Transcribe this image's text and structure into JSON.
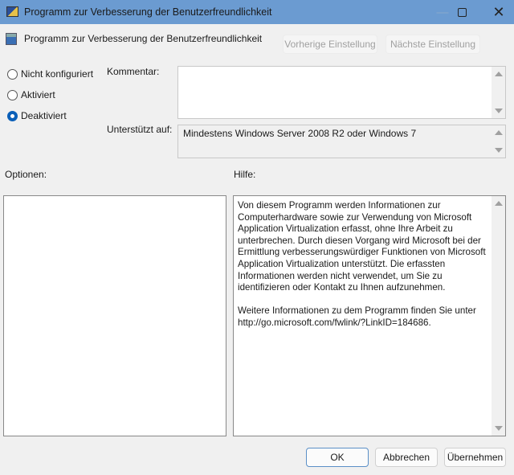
{
  "window": {
    "title": "Programm zur Verbesserung der Benutzerfreundlichkeit"
  },
  "header": {
    "title": "Programm zur Verbesserung der Benutzerfreundlichkeit",
    "prev": "Vorherige Einstellung",
    "next": "Nächste Einstellung"
  },
  "state": {
    "options": [
      "Nicht konfiguriert",
      "Aktiviert",
      "Deaktiviert"
    ],
    "selected": "Deaktiviert"
  },
  "comment": {
    "label": "Kommentar:",
    "value": ""
  },
  "supported": {
    "label": "Unterstützt auf:",
    "value": "Mindestens Windows Server 2008 R2 oder Windows 7"
  },
  "options_label": "Optionen:",
  "help": {
    "label": "Hilfe:",
    "p1": "Von diesem Programm werden Informationen zur Computerhardware sowie zur Verwendung von Microsoft Application Virtualization erfasst, ohne Ihre Arbeit zu unterbrechen. Durch diesen Vorgang wird Microsoft bei der Ermittlung verbesserungswürdiger Funktionen von Microsoft Application Virtualization unterstützt. Die erfassten Informationen werden nicht verwendet, um Sie zu identifizieren oder Kontakt zu Ihnen aufzunehmen.",
    "p2": "Weitere Informationen zu dem Programm finden Sie unter http://go.microsoft.com/fwlink/?LinkID=184686."
  },
  "footer": {
    "ok": "OK",
    "cancel": "Abbrechen",
    "apply": "Übernehmen"
  }
}
